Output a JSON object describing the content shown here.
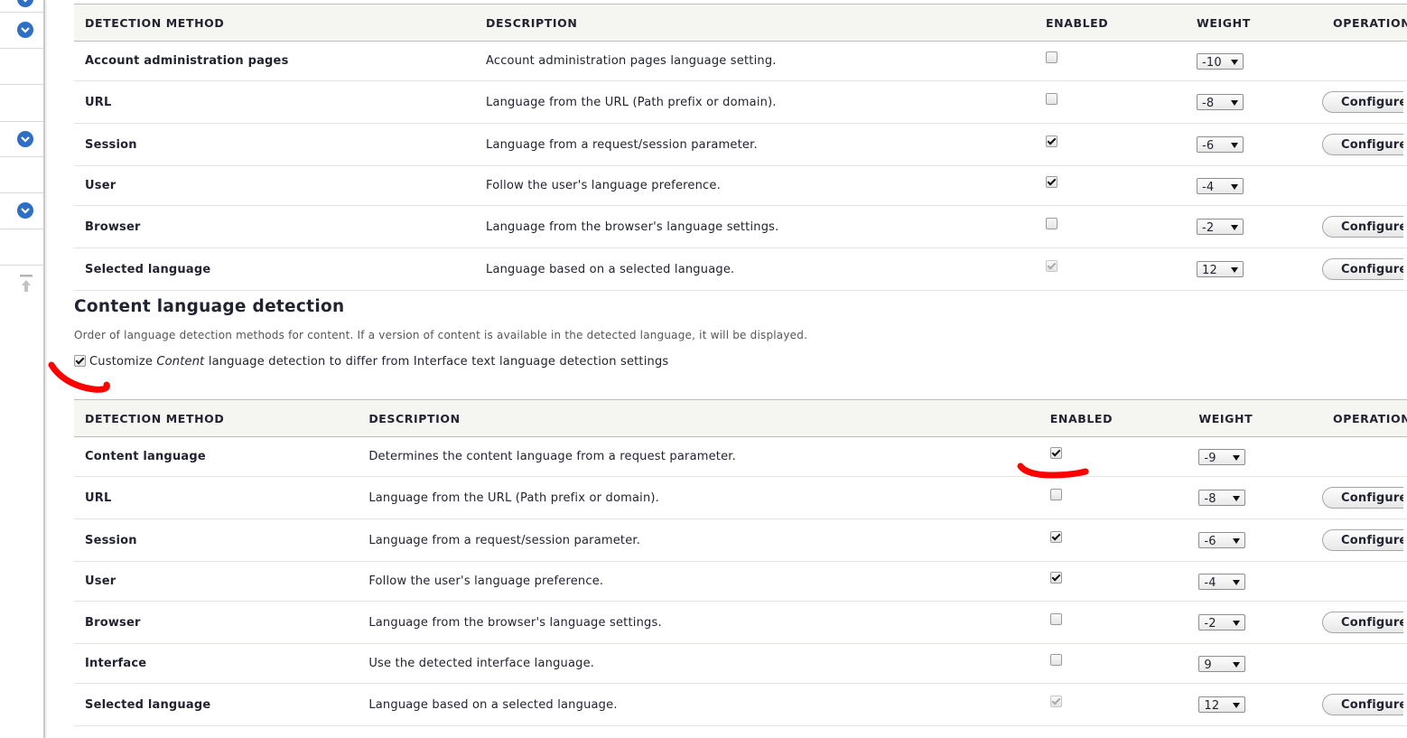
{
  "colors": {
    "accent": "#2f6fc3",
    "annotation": "#ff0000"
  },
  "interface_table": {
    "headers": [
      "DETECTION METHOD",
      "DESCRIPTION",
      "ENABLED",
      "WEIGHT",
      "OPERATIONS"
    ],
    "rows": [
      {
        "method": "Account administration pages",
        "description": "Account administration pages language setting.",
        "enabled": false,
        "disabled": false,
        "weight": "-10",
        "operation": ""
      },
      {
        "method": "URL",
        "description": "Language from the URL (Path prefix or domain).",
        "enabled": false,
        "disabled": false,
        "weight": "-8",
        "operation": "Configure"
      },
      {
        "method": "Session",
        "description": "Language from a request/session parameter.",
        "enabled": true,
        "disabled": false,
        "weight": "-6",
        "operation": "Configure"
      },
      {
        "method": "User",
        "description": "Follow the user's language preference.",
        "enabled": true,
        "disabled": false,
        "weight": "-4",
        "operation": ""
      },
      {
        "method": "Browser",
        "description": "Language from the browser's language settings.",
        "enabled": false,
        "disabled": false,
        "weight": "-2",
        "operation": "Configure"
      },
      {
        "method": "Selected language",
        "description": "Language based on a selected language.",
        "enabled": true,
        "disabled": true,
        "weight": "12",
        "operation": "Configure"
      }
    ]
  },
  "content_section": {
    "title": "Content language detection",
    "description": "Order of language detection methods for content. If a version of content is available in the detected language, it will be displayed.",
    "customize_checked": true,
    "customize_prefix": "Customize ",
    "customize_emph": "Content",
    "customize_suffix": " language detection to differ from Interface text language detection settings"
  },
  "content_table": {
    "headers": [
      "DETECTION METHOD",
      "DESCRIPTION",
      "ENABLED",
      "WEIGHT",
      "OPERATIONS"
    ],
    "rows": [
      {
        "method": "Content language",
        "description": "Determines the content language from a request parameter.",
        "enabled": true,
        "disabled": false,
        "weight": "-9",
        "operation": ""
      },
      {
        "method": "URL",
        "description": "Language from the URL (Path prefix or domain).",
        "enabled": false,
        "disabled": false,
        "weight": "-8",
        "operation": "Configure"
      },
      {
        "method": "Session",
        "description": "Language from a request/session parameter.",
        "enabled": true,
        "disabled": false,
        "weight": "-6",
        "operation": "Configure"
      },
      {
        "method": "User",
        "description": "Follow the user's language preference.",
        "enabled": true,
        "disabled": false,
        "weight": "-4",
        "operation": ""
      },
      {
        "method": "Browser",
        "description": "Language from the browser's language settings.",
        "enabled": false,
        "disabled": false,
        "weight": "-2",
        "operation": "Configure"
      },
      {
        "method": "Interface",
        "description": "Use the detected interface language.",
        "enabled": false,
        "disabled": false,
        "weight": "9",
        "operation": ""
      },
      {
        "method": "Selected language",
        "description": "Language based on a selected language.",
        "enabled": true,
        "disabled": true,
        "weight": "12",
        "operation": "Configure"
      }
    ]
  },
  "sidebar": {
    "icons": [
      "chevron-down-icon",
      "chevron-down-icon",
      "chevron-down-icon",
      "chevron-down-icon",
      "pin-icon"
    ]
  }
}
